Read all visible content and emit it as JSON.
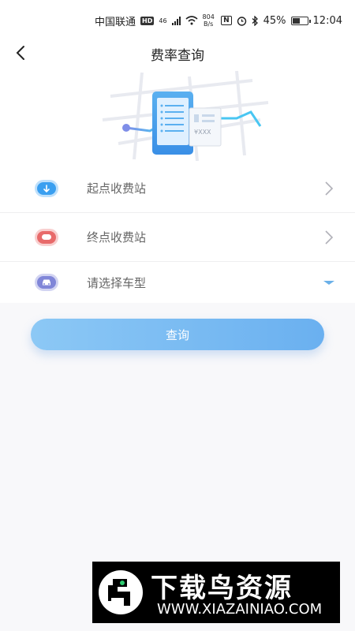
{
  "status_bar": {
    "carrier": "中国联通",
    "hd": "HD",
    "network": "46",
    "speed_value": "804",
    "speed_unit": "B/s",
    "nfc": "N",
    "battery": "45%",
    "time": "12:04"
  },
  "header": {
    "title": "费率查询"
  },
  "banner": {
    "receipt_text": "¥XXX"
  },
  "form": {
    "rows": [
      {
        "label": "起点收费站",
        "icon": "arrow-down-icon",
        "color": "#3a9ff0"
      },
      {
        "label": "终点收费站",
        "icon": "stop-icon",
        "color": "#e86a6a"
      },
      {
        "label": "请选择车型",
        "icon": "car-icon",
        "color": "#8086d8"
      }
    ]
  },
  "query_button": {
    "label": "查询"
  },
  "watermark": {
    "title": "下载鸟资源",
    "url": "WWW.XIAZAINIAO.COM"
  },
  "colors": {
    "accent": "#6ab0f0",
    "dropdown": "#6ab0e8",
    "chevron": "#b0b0b8"
  }
}
